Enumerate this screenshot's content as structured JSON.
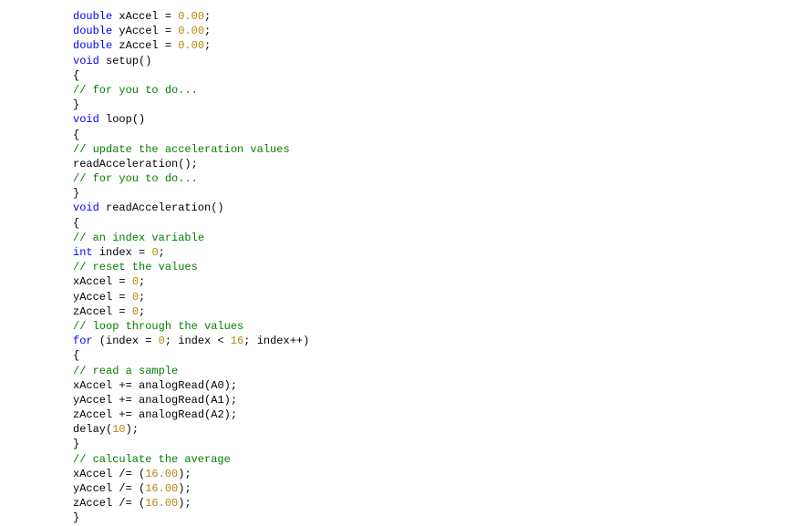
{
  "code": {
    "lines": [
      [
        {
          "cls": "c-keyword",
          "t": "double"
        },
        {
          "cls": "c-ident",
          "t": " xAccel "
        },
        {
          "cls": "c-punct",
          "t": "= "
        },
        {
          "cls": "c-number",
          "t": "0.00"
        },
        {
          "cls": "c-punct",
          "t": ";"
        }
      ],
      [
        {
          "cls": "c-keyword",
          "t": "double"
        },
        {
          "cls": "c-ident",
          "t": " yAccel "
        },
        {
          "cls": "c-punct",
          "t": "= "
        },
        {
          "cls": "c-number",
          "t": "0.00"
        },
        {
          "cls": "c-punct",
          "t": ";"
        }
      ],
      [
        {
          "cls": "c-keyword",
          "t": "double"
        },
        {
          "cls": "c-ident",
          "t": " zAccel "
        },
        {
          "cls": "c-punct",
          "t": "= "
        },
        {
          "cls": "c-number",
          "t": "0.00"
        },
        {
          "cls": "c-punct",
          "t": ";"
        }
      ],
      [
        {
          "cls": "c-keyword",
          "t": "void"
        },
        {
          "cls": "c-ident",
          "t": " setup"
        },
        {
          "cls": "c-punct",
          "t": "()"
        }
      ],
      [
        {
          "cls": "c-punct",
          "t": "{"
        }
      ],
      [
        {
          "cls": "c-comment",
          "t": "// for you to do..."
        }
      ],
      [
        {
          "cls": "c-punct",
          "t": "}"
        }
      ],
      [
        {
          "cls": "c-keyword",
          "t": "void"
        },
        {
          "cls": "c-ident",
          "t": " loop"
        },
        {
          "cls": "c-punct",
          "t": "()"
        }
      ],
      [
        {
          "cls": "c-punct",
          "t": "{"
        }
      ],
      [
        {
          "cls": "c-comment",
          "t": "// update the acceleration values"
        }
      ],
      [
        {
          "cls": "c-ident",
          "t": "readAcceleration"
        },
        {
          "cls": "c-punct",
          "t": "();"
        }
      ],
      [
        {
          "cls": "c-comment",
          "t": "// for you to do..."
        }
      ],
      [
        {
          "cls": "c-punct",
          "t": "}"
        }
      ],
      [
        {
          "cls": "c-keyword",
          "t": "void"
        },
        {
          "cls": "c-ident",
          "t": " readAcceleration"
        },
        {
          "cls": "c-punct",
          "t": "()"
        }
      ],
      [
        {
          "cls": "c-punct",
          "t": "{"
        }
      ],
      [
        {
          "cls": "c-comment",
          "t": "// an index variable"
        }
      ],
      [
        {
          "cls": "c-keyword",
          "t": "int"
        },
        {
          "cls": "c-ident",
          "t": " index "
        },
        {
          "cls": "c-punct",
          "t": "= "
        },
        {
          "cls": "c-number",
          "t": "0"
        },
        {
          "cls": "c-punct",
          "t": ";"
        }
      ],
      [
        {
          "cls": "c-comment",
          "t": "// reset the values"
        }
      ],
      [
        {
          "cls": "c-ident",
          "t": "xAccel "
        },
        {
          "cls": "c-punct",
          "t": "= "
        },
        {
          "cls": "c-number",
          "t": "0"
        },
        {
          "cls": "c-punct",
          "t": ";"
        }
      ],
      [
        {
          "cls": "c-ident",
          "t": "yAccel "
        },
        {
          "cls": "c-punct",
          "t": "= "
        },
        {
          "cls": "c-number",
          "t": "0"
        },
        {
          "cls": "c-punct",
          "t": ";"
        }
      ],
      [
        {
          "cls": "c-ident",
          "t": "zAccel "
        },
        {
          "cls": "c-punct",
          "t": "= "
        },
        {
          "cls": "c-number",
          "t": "0"
        },
        {
          "cls": "c-punct",
          "t": ";"
        }
      ],
      [
        {
          "cls": "c-comment",
          "t": "// loop through the values"
        }
      ],
      [
        {
          "cls": "c-keyword",
          "t": "for"
        },
        {
          "cls": "c-punct",
          "t": " ("
        },
        {
          "cls": "c-ident",
          "t": "index "
        },
        {
          "cls": "c-punct",
          "t": "= "
        },
        {
          "cls": "c-number",
          "t": "0"
        },
        {
          "cls": "c-punct",
          "t": "; "
        },
        {
          "cls": "c-ident",
          "t": "index "
        },
        {
          "cls": "c-punct",
          "t": "< "
        },
        {
          "cls": "c-number",
          "t": "16"
        },
        {
          "cls": "c-punct",
          "t": "; "
        },
        {
          "cls": "c-ident",
          "t": "index"
        },
        {
          "cls": "c-punct",
          "t": "++)"
        }
      ],
      [
        {
          "cls": "c-punct",
          "t": "{"
        }
      ],
      [
        {
          "cls": "c-comment",
          "t": "// read a sample"
        }
      ],
      [
        {
          "cls": "c-ident",
          "t": "xAccel "
        },
        {
          "cls": "c-punct",
          "t": "+= "
        },
        {
          "cls": "c-ident",
          "t": "analogRead"
        },
        {
          "cls": "c-punct",
          "t": "("
        },
        {
          "cls": "c-ident",
          "t": "A0"
        },
        {
          "cls": "c-punct",
          "t": ");"
        }
      ],
      [
        {
          "cls": "c-ident",
          "t": "yAccel "
        },
        {
          "cls": "c-punct",
          "t": "+= "
        },
        {
          "cls": "c-ident",
          "t": "analogRead"
        },
        {
          "cls": "c-punct",
          "t": "("
        },
        {
          "cls": "c-ident",
          "t": "A1"
        },
        {
          "cls": "c-punct",
          "t": ");"
        }
      ],
      [
        {
          "cls": "c-ident",
          "t": "zAccel "
        },
        {
          "cls": "c-punct",
          "t": "+= "
        },
        {
          "cls": "c-ident",
          "t": "analogRead"
        },
        {
          "cls": "c-punct",
          "t": "("
        },
        {
          "cls": "c-ident",
          "t": "A2"
        },
        {
          "cls": "c-punct",
          "t": ");"
        }
      ],
      [
        {
          "cls": "c-ident",
          "t": "delay"
        },
        {
          "cls": "c-punct",
          "t": "("
        },
        {
          "cls": "c-number",
          "t": "10"
        },
        {
          "cls": "c-punct",
          "t": ");"
        }
      ],
      [
        {
          "cls": "c-punct",
          "t": "}"
        }
      ],
      [
        {
          "cls": "c-comment",
          "t": "// calculate the average"
        }
      ],
      [
        {
          "cls": "c-ident",
          "t": "xAccel "
        },
        {
          "cls": "c-punct",
          "t": "/= ("
        },
        {
          "cls": "c-number",
          "t": "16.00"
        },
        {
          "cls": "c-punct",
          "t": ");"
        }
      ],
      [
        {
          "cls": "c-ident",
          "t": "yAccel "
        },
        {
          "cls": "c-punct",
          "t": "/= ("
        },
        {
          "cls": "c-number",
          "t": "16.00"
        },
        {
          "cls": "c-punct",
          "t": ");"
        }
      ],
      [
        {
          "cls": "c-ident",
          "t": "zAccel "
        },
        {
          "cls": "c-punct",
          "t": "/= ("
        },
        {
          "cls": "c-number",
          "t": "16.00"
        },
        {
          "cls": "c-punct",
          "t": ");"
        }
      ],
      [
        {
          "cls": "c-punct",
          "t": "}"
        }
      ]
    ]
  }
}
